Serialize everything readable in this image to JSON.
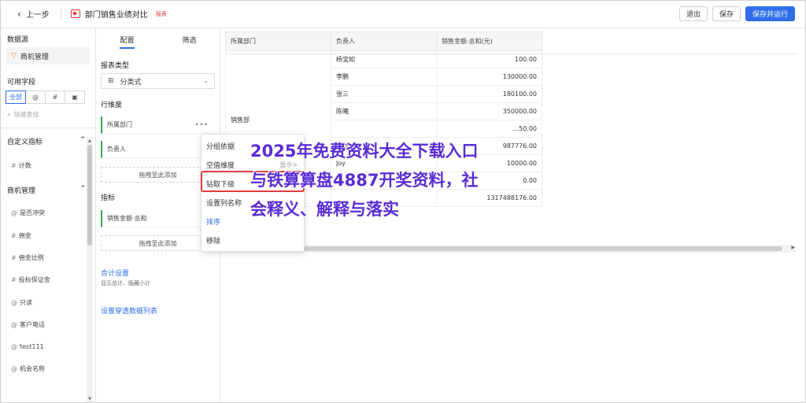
{
  "header": {
    "back_label": "上一步",
    "title": "部门销售业绩对比",
    "tag": "报表",
    "buttons": {
      "exit": "退出",
      "save": "保存",
      "save_run": "保存并运行"
    }
  },
  "left": {
    "datasource_label": "数据源",
    "datasource": "商机管理",
    "fields_label": "可用字段",
    "filter_tabs": [
      "全部",
      "@",
      "#",
      "▣"
    ],
    "search_placeholder": "快速查找",
    "custom_group": "自定义指标",
    "custom_fields": [
      {
        "prefix": "#",
        "label": "计数"
      }
    ],
    "biz_group": "商机管理",
    "biz_fields": [
      {
        "prefix": "@",
        "label": "是否冲突"
      },
      {
        "prefix": "#",
        "label": "佣金"
      },
      {
        "prefix": "#",
        "label": "佣金比例"
      },
      {
        "prefix": "#",
        "label": "投标保证金"
      },
      {
        "prefix": "@",
        "label": "只读"
      },
      {
        "prefix": "@",
        "label": "客户电话"
      },
      {
        "prefix": "@",
        "label": "test111"
      },
      {
        "prefix": "@",
        "label": "机会名称"
      }
    ]
  },
  "config": {
    "tabs": [
      "配置",
      "筛选"
    ],
    "report_type_label": "报表类型",
    "report_type": "分类式",
    "row_dim_label": "行维度",
    "row_dims": [
      "所属部门",
      "负责人"
    ],
    "drop_hint": "拖拽至此添加",
    "metric_label": "指标",
    "metrics": [
      "销售金额·总和"
    ],
    "total_settings": "合计设置",
    "total_hint": "显示总计、隐藏小计",
    "drill_list": "设置穿透数据列表"
  },
  "menu": {
    "items": [
      "分组依据",
      "空值维度",
      "钻取下级",
      "设置列名称",
      "排序",
      "移除"
    ],
    "empty_value_display": "显示>"
  },
  "table": {
    "headers": [
      "所属部门",
      "负责人",
      "销售金额·总和(元)"
    ],
    "department": "销售部",
    "rows": [
      {
        "person": "杨宝如",
        "amount": "100.00"
      },
      {
        "person": "李鹏",
        "amount": "130000.00"
      },
      {
        "person": "张三",
        "amount": "180100.00"
      },
      {
        "person": "陈曦",
        "amount": "350000.00"
      },
      {
        "person": "",
        "amount": "...50.00"
      },
      {
        "person": "何龙",
        "amount": "987776.00"
      },
      {
        "person": "Joy",
        "amount": "10000.00"
      },
      {
        "person": "-",
        "amount": "0.00"
      }
    ],
    "total": "1317488176.00"
  },
  "overlay_text": "2025年免费资料大全下载入口\n与铁算算盘4887开奖资料，社\n会释义、解释与落实",
  "colors": {
    "accent": "#2f6ee8",
    "danger": "#e23c3c",
    "overlay": "#5a2cd6",
    "dim_bar": "#3aa657"
  }
}
